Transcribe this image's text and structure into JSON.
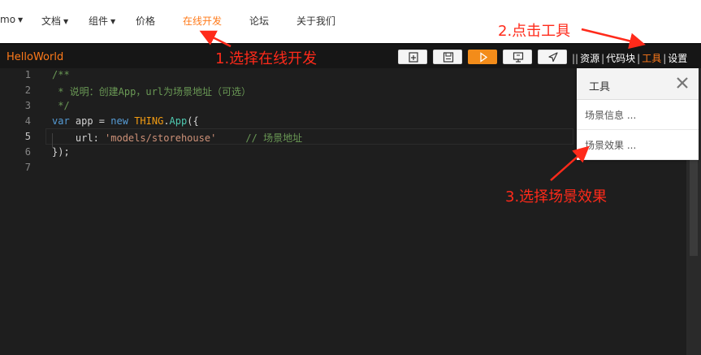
{
  "topnav": {
    "items": [
      {
        "label": "mo",
        "has_caret": true
      },
      {
        "label": "文档",
        "has_caret": true
      },
      {
        "label": "组件",
        "has_caret": true
      },
      {
        "label": "价格",
        "has_caret": false
      },
      {
        "label": "在线开发",
        "has_caret": false,
        "active": true
      },
      {
        "label": "论坛",
        "has_caret": false
      },
      {
        "label": "关于我们",
        "has_caret": false
      }
    ]
  },
  "toolbar": {
    "app_name": "HelloWorld",
    "buttons": [
      "new-file-icon",
      "save-icon",
      "run-icon",
      "screen-icon",
      "send-icon"
    ],
    "links": {
      "resources": "资源",
      "snippets": "代码块",
      "tools": "工具",
      "settings": "设置"
    },
    "active_link": "工具",
    "accent_color": "#ff7a1a"
  },
  "editor": {
    "line_numbers": [
      "1",
      "2",
      "3",
      "4",
      "5",
      "6",
      "7"
    ],
    "current_line": "5",
    "code": {
      "l1": "/**",
      "l2": " * 说明：创建App，url为场景地址（可选）",
      "l3": " */",
      "l4_kw": "var",
      "l4_mid": " app = ",
      "l4_new": "new",
      "l4_obj": "THING",
      "l4_dot": ".",
      "l4_fn": "App",
      "l4_end": "({",
      "l5_key": "    url: ",
      "l5_str": "'models/storehouse'",
      "l5_comment": "     // 场景地址",
      "l6": "});",
      "l7": ""
    }
  },
  "tools_panel": {
    "title": "工具",
    "items": [
      "场景信息 ...",
      "场景效果 ..."
    ]
  },
  "annotations": {
    "step1": "1.选择在线开发",
    "step2": "2.点击工具",
    "step3": "3.选择场景效果",
    "color": "#ff2a1a"
  }
}
